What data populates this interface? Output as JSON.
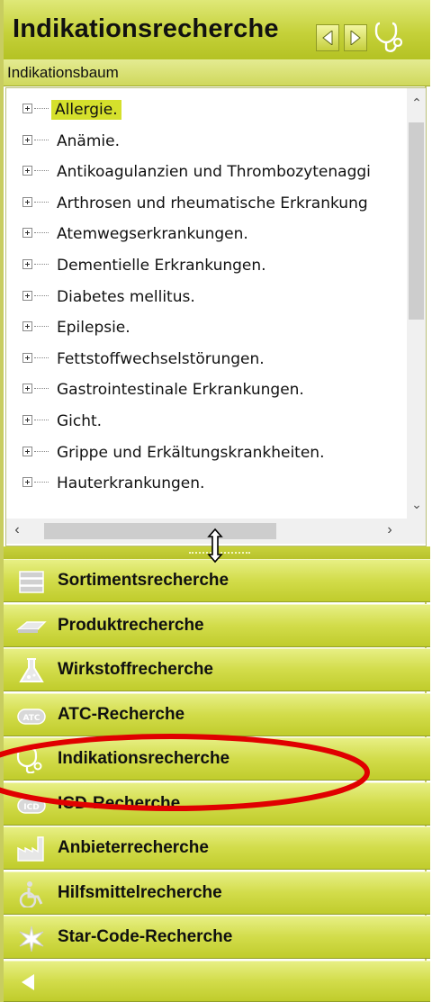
{
  "header": {
    "title": "Indikationsrecherche"
  },
  "subheader": {
    "label": "Indikationsbaum"
  },
  "tree": {
    "items": [
      "Allergie.",
      "Anämie.",
      "Antikoagulanzien und Thrombozytenaggi",
      "Arthrosen und rheumatische Erkrankung",
      "Atemwegserkrankungen.",
      "Dementielle Erkrankungen.",
      "Diabetes mellitus.",
      "Epilepsie.",
      "Fettstoffwechselstörungen.",
      "Gastrointestinale Erkrankungen.",
      "Gicht.",
      "Grippe und Erkältungskrankheiten.",
      "Hauterkrankungen."
    ],
    "selected": "Allergie."
  },
  "stack": {
    "items": [
      {
        "label": "Sortimentsrecherche",
        "icon": "sortiment-icon"
      },
      {
        "label": "Produktrecherche",
        "icon": "product-icon"
      },
      {
        "label": "Wirkstoffrecherche",
        "icon": "flask-icon"
      },
      {
        "label": "ATC-Recherche",
        "icon": "atc-icon",
        "badge": "ATC"
      },
      {
        "label": "Indikationsrecherche",
        "icon": "stethoscope-icon"
      },
      {
        "label": "ICD-Recherche",
        "icon": "icd-icon",
        "badge": "ICD"
      },
      {
        "label": "Anbieterrecherche",
        "icon": "factory-icon"
      },
      {
        "label": "Hilfsmittelrecherche",
        "icon": "wheelchair-icon"
      },
      {
        "label": "Star-Code-Recherche",
        "icon": "star-icon"
      }
    ]
  },
  "colors": {
    "accent": "#c5d13a",
    "highlight": "#e00000",
    "selection": "#d5e02c"
  }
}
